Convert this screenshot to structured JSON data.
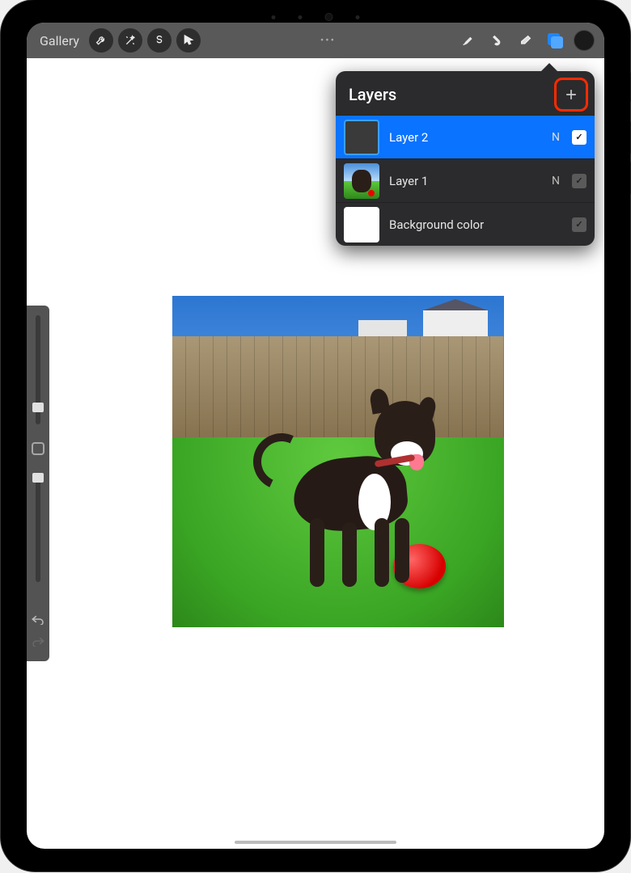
{
  "toolbar": {
    "gallery_label": "Gallery"
  },
  "layers_panel": {
    "title": "Layers",
    "rows": [
      {
        "name": "Layer 2",
        "blend": "N",
        "selected": true
      },
      {
        "name": "Layer 1",
        "blend": "N",
        "selected": false
      },
      {
        "name": "Background color",
        "blend": "",
        "selected": false
      }
    ]
  }
}
